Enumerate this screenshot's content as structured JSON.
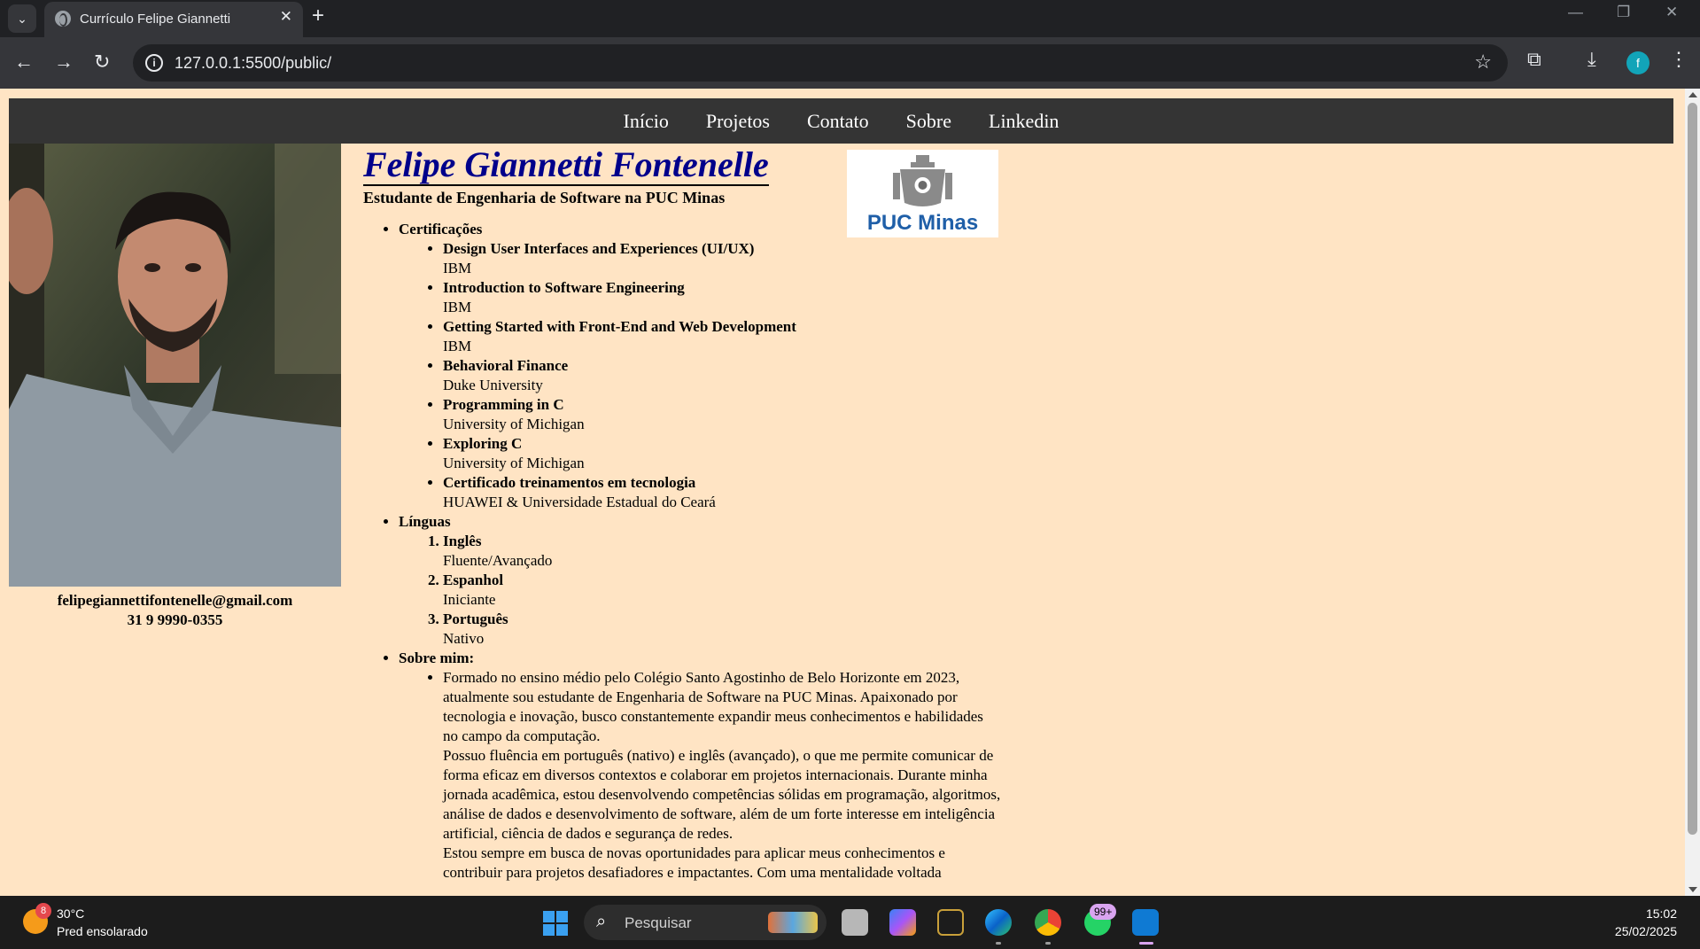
{
  "browser": {
    "tab_title": "Currículo Felipe Giannetti",
    "url": "127.0.0.1:5500/public/",
    "profile_initial": "f"
  },
  "site_nav": [
    "Início",
    "Projetos",
    "Contato",
    "Sobre",
    "Linkedin"
  ],
  "profile": {
    "name": "Felipe Giannetti Fontenelle",
    "subtitle": "Estudante de Engenharia de Software na PUC Minas",
    "email": "felipegiannettifontenelle@gmail.com",
    "phone": "31 9 9990-0355",
    "logo_text": "PUC Minas"
  },
  "certificacoes": {
    "heading": "Certificações",
    "items": [
      {
        "title": "Design User Interfaces and Experiences (UI/UX)",
        "issuer": "IBM"
      },
      {
        "title": "Introduction to Software Engineering",
        "issuer": "IBM"
      },
      {
        "title": "Getting Started with Front-End and Web Development",
        "issuer": "IBM"
      },
      {
        "title": "Behavioral Finance",
        "issuer": "Duke University"
      },
      {
        "title": "Programming in C",
        "issuer": "University of Michigan"
      },
      {
        "title": "Exploring C",
        "issuer": "University of Michigan"
      },
      {
        "title": "Certificado treinamentos em tecnologia",
        "issuer": "HUAWEI & Universidade Estadual do Ceará"
      }
    ]
  },
  "linguas": {
    "heading": "Línguas",
    "items": [
      {
        "language": "Inglês",
        "level": "Fluente/Avançado"
      },
      {
        "language": "Espanhol",
        "level": "Iniciante"
      },
      {
        "language": "Português",
        "level": "Nativo"
      }
    ]
  },
  "sobre": {
    "heading": "Sobre mim:",
    "paragraphs": [
      "Formado no ensino médio pelo Colégio Santo Agostinho de Belo Horizonte em 2023, atualmente sou estudante de Engenharia de Software na PUC Minas. Apaixonado por tecnologia e inovação, busco constantemente expandir meus conhecimentos e habilidades no campo da computação.",
      "Possuo fluência em português (nativo) e inglês (avançado), o que me permite comunicar de forma eficaz em diversos contextos e colaborar em projetos internacionais. Durante minha jornada acadêmica, estou desenvolvendo competências sólidas em programação, algoritmos, análise de dados e desenvolvimento de software, além de um forte interesse em inteligência artificial, ciência de dados e segurança de redes.",
      "Estou sempre em busca de novas oportunidades para aplicar meus conhecimentos e contribuir para projetos desafiadores e impactantes. Com uma mentalidade voltada"
    ]
  },
  "taskbar": {
    "weather_badge": "8",
    "temperature": "30°C",
    "weather_desc": "Pred ensolarado",
    "search_label": "Pesquisar",
    "whatsapp_badge": "99+",
    "time": "15:02",
    "date": "25/02/2025"
  },
  "colors": {
    "page_bg": "#ffe4c4",
    "nav_bg": "#343434",
    "name_color": "#00008b"
  }
}
